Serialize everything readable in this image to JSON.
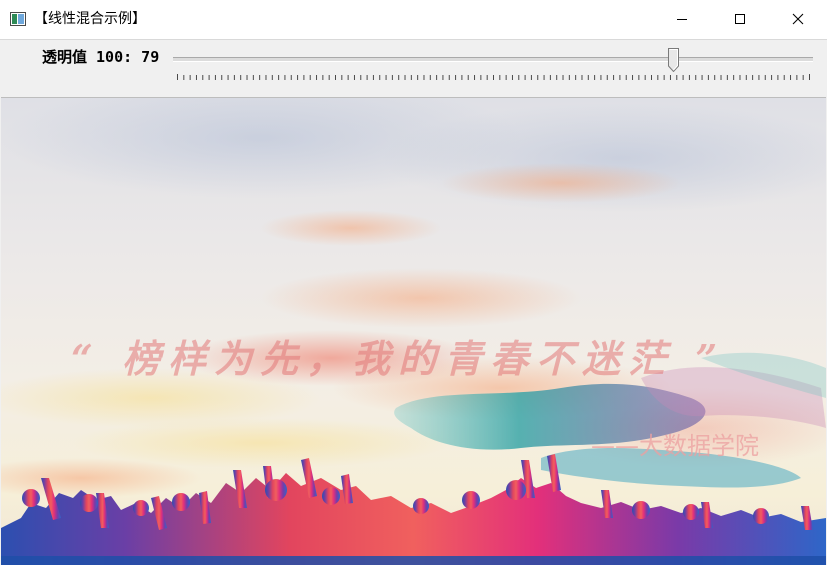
{
  "window": {
    "title": "【线性混合示例】",
    "icon": "app-window-icon",
    "controls": [
      "minimize-icon",
      "maximize-icon",
      "close-icon"
    ]
  },
  "trackbar": {
    "label": "透明值 100: 79",
    "value": 79,
    "max": 100
  },
  "image": {
    "slogan": "“ 榜样为先，我的青春不迷茫 ”",
    "attribution": "——大数据学院"
  }
}
